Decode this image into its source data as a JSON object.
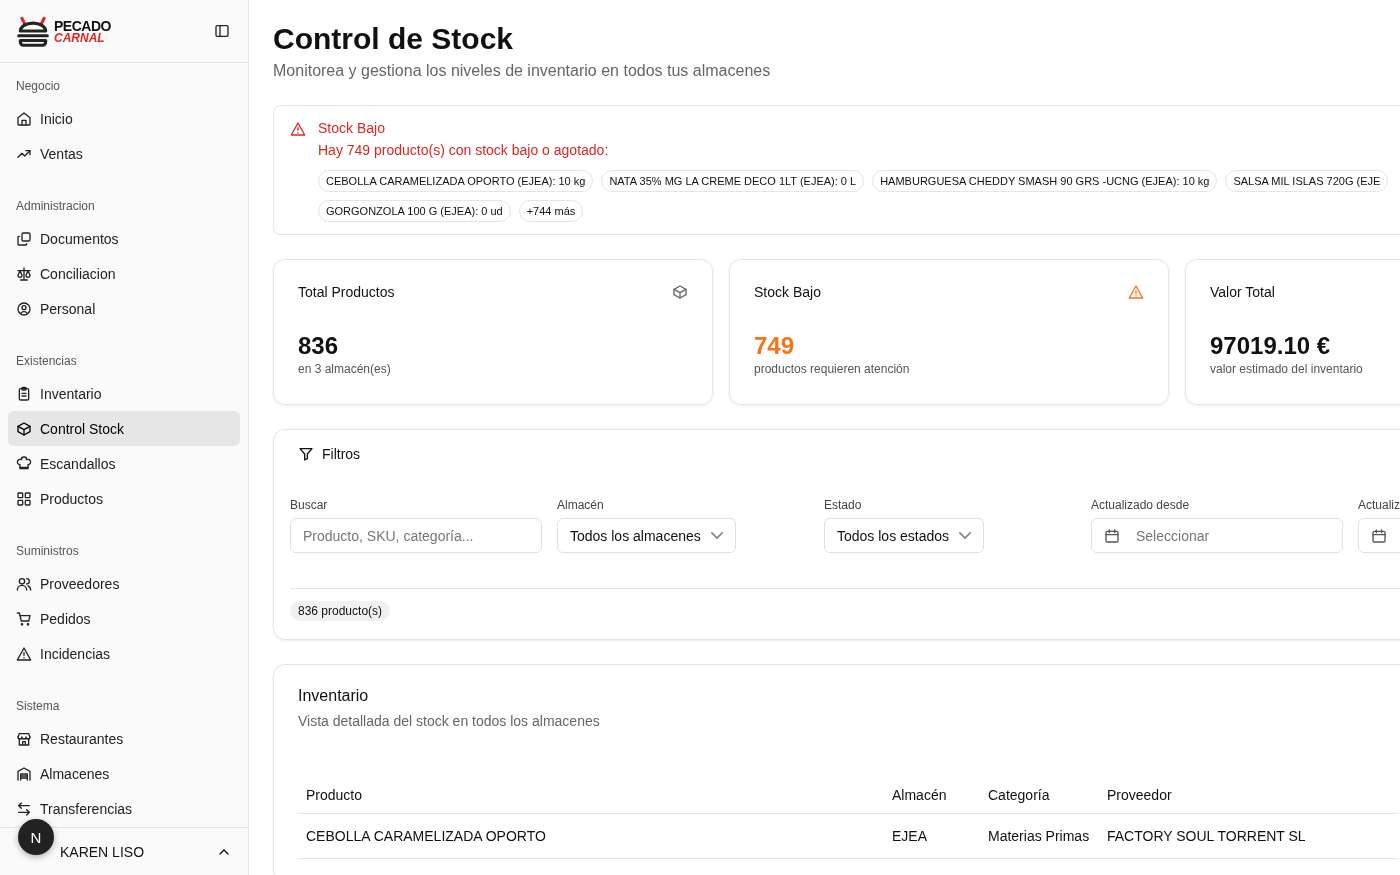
{
  "sidebar": {
    "logo": {
      "line_1": "PECADO",
      "line_2": "CARNAL"
    },
    "sections": [
      {
        "title": "Negocio",
        "items": [
          {
            "label": "Inicio",
            "selected": false
          },
          {
            "label": "Ventas",
            "selected": false
          }
        ]
      },
      {
        "title": "Administracion",
        "items": [
          {
            "label": "Documentos",
            "selected": false
          },
          {
            "label": "Conciliacion",
            "selected": false
          },
          {
            "label": "Personal",
            "selected": false
          }
        ]
      },
      {
        "title": "Existencias",
        "items": [
          {
            "label": "Inventario",
            "selected": false
          },
          {
            "label": "Control Stock",
            "selected": true
          },
          {
            "label": "Escandallos",
            "selected": false
          },
          {
            "label": "Productos",
            "selected": false
          }
        ]
      },
      {
        "title": "Suministros",
        "items": [
          {
            "label": "Proveedores",
            "selected": false
          },
          {
            "label": "Pedidos",
            "selected": false
          },
          {
            "label": "Incidencias",
            "selected": false
          }
        ]
      },
      {
        "title": "Sistema",
        "items": [
          {
            "label": "Restaurantes",
            "selected": false
          },
          {
            "label": "Almacenes",
            "selected": false
          },
          {
            "label": "Transferencias",
            "selected": false
          }
        ]
      }
    ],
    "user": {
      "name": "KAREN LISO",
      "avatar": "N"
    }
  },
  "page": {
    "title": "Control de Stock",
    "subtitle": "Monitorea y gestiona los niveles de inventario en todos tus almacenes"
  },
  "alert": {
    "title": "Stock Bajo",
    "message": "Hay 749 producto(s) con stock bajo o agotado:",
    "chips": [
      "CEBOLLA CARAMELIZADA OPORTO (EJEA): 10 kg",
      "NATA 35% MG LA CREME DECO 1LT (EJEA): 0 L",
      "HAMBURGUESA CHEDDY SMASH 90 GRS -UCNG (EJEA): 10 kg",
      "SALSA MIL ISLAS 720G (EJE",
      "GORGONZOLA 100 G (EJEA): 0 ud",
      "+744 más"
    ]
  },
  "stats": [
    {
      "title": "Total Productos",
      "value": "836",
      "caption": "en 3 almacén(es)",
      "kind": "normal"
    },
    {
      "title": "Stock Bajo",
      "value": "749",
      "caption": "productos requieren atención",
      "kind": "warning"
    },
    {
      "title": "Valor Total",
      "value": "97019.10 €",
      "caption": "valor estimado del inventario",
      "kind": "normal"
    }
  ],
  "filters": {
    "title": "Filtros",
    "fields": [
      {
        "label": "Buscar",
        "kind": "search",
        "placeholder": "Producto, SKU, categoría..."
      },
      {
        "label": "Almacén",
        "kind": "select",
        "value": "Todos los almacenes"
      },
      {
        "label": "Estado",
        "kind": "select",
        "value": "Todos los estados"
      },
      {
        "label": "Actualizado desde",
        "kind": "date",
        "placeholder": "Seleccionar"
      },
      {
        "label": "Actualiz",
        "kind": "date"
      }
    ],
    "count": "836 producto(s)"
  },
  "inventory": {
    "title": "Inventario",
    "subtitle": "Vista detallada del stock en todos los almacenes",
    "columns": [
      "Producto",
      "Almacén",
      "Categoría",
      "Proveedor"
    ],
    "rows": [
      [
        "CEBOLLA CARAMELIZADA OPORTO",
        "EJEA",
        "Materias Primas",
        "FACTORY SOUL TORRENT SL"
      ]
    ]
  }
}
